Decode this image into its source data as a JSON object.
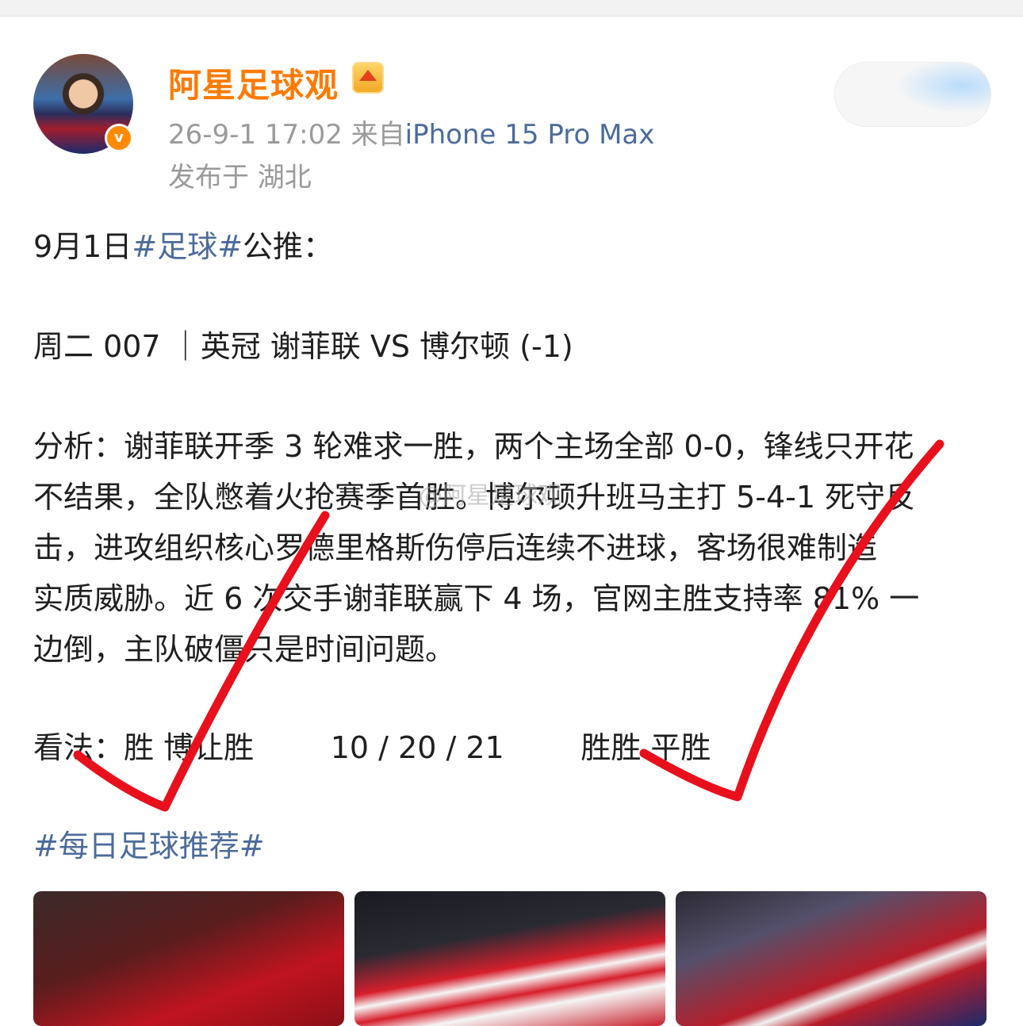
{
  "user": {
    "name": "阿星足球观",
    "time": "26-9-1 17:02",
    "from_label": "来自",
    "device": "iPhone 15 Pro Max",
    "location": "发布于 湖北",
    "verified_badge": "v"
  },
  "post": {
    "line1_prefix": "9月1日",
    "line1_tag": "#足球#",
    "line1_suffix": "公推：",
    "match": "周二 007 ｜英冠 谢菲联 VS 博尔顿 (-1)",
    "analysis_lines": [
      "分析：谢菲联开季 3 轮难求一胜，两个主场全部 0-0，锋线只开花",
      "不结果，全队憋着火抢赛季首胜。博尔顿升班马主打 5-4-1 死守反",
      "击，进攻组织核心罗德里格斯伤停后连续不进球，客场很难制造",
      "实质威胁。近 6 次交手谢菲联赢下 4 场，官网主胜支持率 81% 一",
      "边倒，主队破僵只是时间问题。"
    ],
    "view": "看法：胜 博让胜        10 / 20 / 21        胜胜 平胜",
    "topic_tag": "#每日足球推荐#",
    "watermark": "@阿星足球观"
  },
  "icons": [
    "avatar",
    "verified-icon",
    "vip-crown-icon",
    "checkmark-icon",
    "checkmark-icon"
  ],
  "colors": {
    "name": "#ff7a00",
    "link": "#4c6b9a",
    "meta": "#9a9a9a",
    "check": "#e8101c"
  },
  "thumbnails": [
    "football-photo-1",
    "football-photo-2",
    "football-photo-3"
  ]
}
